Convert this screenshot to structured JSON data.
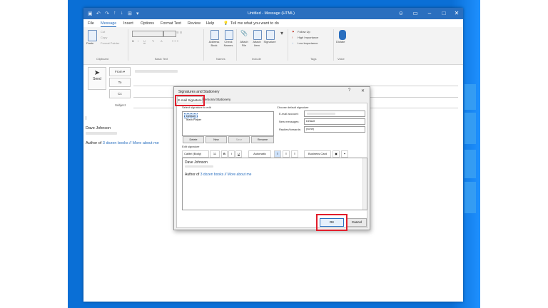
{
  "window": {
    "title": "Untitled  -  Message (HTML)",
    "tell_me": "Tell me what you want to do"
  },
  "menu": [
    "File",
    "Message",
    "Insert",
    "Options",
    "Format Text",
    "Review",
    "Help"
  ],
  "ribbon": {
    "paste": "Paste",
    "cut": "Cut",
    "copy": "Copy",
    "format_painter": "Format Painter",
    "clipboard": "Clipboard",
    "basic_text": "Basic Text",
    "address_book": "Address Book",
    "check_names": "Check Names",
    "names": "Names",
    "attach_file": "Attach File",
    "attach_item": "Attach Item",
    "signature": "Signature",
    "include": "Include",
    "follow_up": "Follow Up",
    "high_importance": "High Importance",
    "low_importance": "Low Importance",
    "tags": "Tags",
    "dictate": "Dictate",
    "voice": "Voice"
  },
  "compose": {
    "send": "Send",
    "from": "From",
    "to": "To",
    "cc": "Cc",
    "subject": "Subject",
    "name": "Dave Johnson",
    "author_prefix": "Author of ",
    "author_link1": "3 dozen books",
    "author_sep": " // ",
    "author_link2": "More about me"
  },
  "dialog": {
    "title": "Signatures and Stationery",
    "help": "?",
    "tab_email": "E-mail Signature",
    "tab_stationery": "Personal Stationery",
    "select_label": "Select signature to edit",
    "signatures": [
      "Default",
      "Team Player"
    ],
    "delete": "Delete",
    "new": "New",
    "save": "Save",
    "rename": "Rename",
    "choose_default": "Choose default signature",
    "email_account": "E-mail account:",
    "new_messages": "New messages:",
    "new_messages_value": "Default",
    "replies": "Replies/forwards:",
    "replies_value": "(none)",
    "edit_signature": "Edit signature",
    "font": "Calibri (Body)",
    "font_size": "11",
    "bold": "B",
    "italic": "I",
    "underline": "U",
    "color": "Automatic",
    "business_card": "Business Card",
    "ok": "OK",
    "cancel": "Cancel"
  }
}
